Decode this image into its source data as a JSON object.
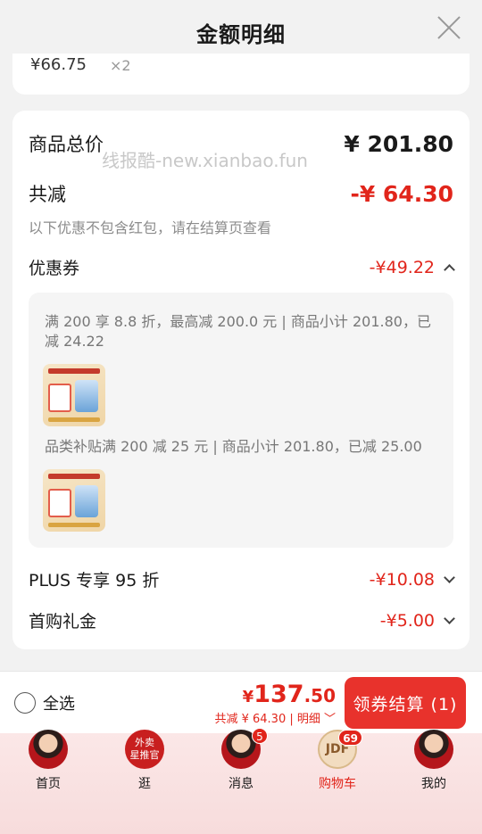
{
  "header": {
    "title": "金额明细"
  },
  "prev_item": {
    "price": "¥66.75",
    "qty": "×2"
  },
  "summary": {
    "total_label": "商品总价",
    "total_value": "¥ 201.80",
    "reduce_label": "共减",
    "reduce_value": "-¥ 64.30",
    "note": "以下优惠不包含红包，请在结算页查看"
  },
  "watermark": "线报酷-new.xianbao.fun",
  "coupon": {
    "label": "优惠券",
    "amount": "-¥49.22",
    "details": [
      {
        "text": "满 200 享 8.8 折，最高减 200.0 元 | 商品小计 201.80，已减 24.22"
      },
      {
        "text": "品类补贴满 200 减 25 元 | 商品小计 201.80，已减 25.00"
      }
    ]
  },
  "plus": {
    "label": "PLUS 专享 95 折",
    "amount": "-¥10.08"
  },
  "first_gift": {
    "label": "首购礼金",
    "amount": "-¥5.00"
  },
  "bottom_bar": {
    "select_all": "全选",
    "pay_currency": "¥",
    "pay_int": "137",
    "pay_dec": ".50",
    "sub_reduce": "共减 ¥ 64.30 | 明细 ﹀",
    "checkout": "领券结算 (1)"
  },
  "tabbar": {
    "items": [
      {
        "label": "首页"
      },
      {
        "label": "逛",
        "avatar_text_1": "外卖",
        "avatar_text_2": "星推官"
      },
      {
        "label": "消息",
        "badge": "5"
      },
      {
        "label": "购物车",
        "badge": "69",
        "avatar_text": "JDF"
      },
      {
        "label": "我的"
      }
    ]
  },
  "colors": {
    "accent": "#e1251b",
    "checkout_bg": "#e8322c"
  }
}
